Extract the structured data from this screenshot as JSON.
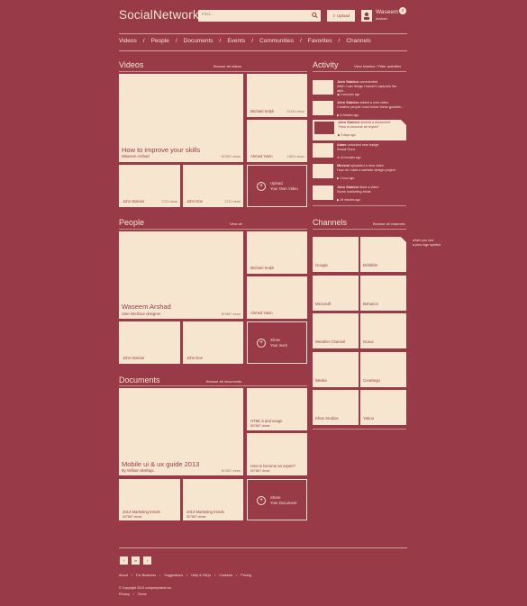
{
  "header": {
    "logo_a": "Social",
    "logo_b": "Network",
    "search_placeholder": "Find...",
    "upload_label": "Upload",
    "user_first": "Waseem",
    "user_last": "Arshad",
    "notif_count": "2"
  },
  "nav": [
    "Videos",
    "People",
    "Documents",
    "Events",
    "Communities",
    "Favorites",
    "Channels"
  ],
  "videos": {
    "title": "Videos",
    "link": "Browse all videos",
    "feature_title": "How to improve your skills",
    "feature_author": "Waseem Arshad",
    "feature_views": "507867 views",
    "s1_name": "Michael Kelph",
    "s1_views": "37434 views",
    "s2_name": "Ahmed Yasin",
    "s2_views": "13804 views",
    "s3_name": "John Stainior",
    "s3_views": "2723 views",
    "s4_name": "John Doe",
    "s4_views": "2723 views",
    "upload_l1": "Upload",
    "upload_l2": "Your Own Video"
  },
  "people": {
    "title": "People",
    "link": "View all",
    "feature_name": "Waseem Arshad",
    "feature_role": "User interface designer",
    "feature_views": "507867 views",
    "s1_name": "Michael Kelph",
    "s2_name": "Ahmed Yasin",
    "s3_name": "John Stainior",
    "s4_name": "John Doe",
    "show_l1": "Show",
    "show_l2": "Your work"
  },
  "documents": {
    "title": "Documents",
    "link": "Browse all documents",
    "feature_title": "Mobile ui & ux guide 2013",
    "feature_author": "By William Mathaja",
    "feature_views": "507867 views",
    "s1_title": "HTML 5 and usage",
    "s1_views": "507867 views",
    "s2_title": "How to become an expert?",
    "s2_views": "507867 views",
    "s3_title": "2013 Marketing trends",
    "s3_views": "507867 views",
    "s4_title": "2013 Marketing trends",
    "s4_views": "507867 views",
    "share_l1": "Share",
    "share_l2": "Your Document"
  },
  "activity": {
    "title": "Activity",
    "link": "View timeline / Filter activities",
    "items": [
      {
        "name": "John Stainior",
        "action": "commented",
        "text": "Wish I can things I haven't captures the abili...",
        "time": "2 seconds ago"
      },
      {
        "name": "John Stainior",
        "action": "added a new video",
        "text": "Creative people must follow these guidelin...",
        "time": "8 minutes ago"
      },
      {
        "name": "John Stainior",
        "action": "shared a document",
        "text": "\"How to become an expert\"",
        "time": "3 days ago"
      },
      {
        "name": "Adam",
        "action": "unlocked new badge",
        "text": "Social Guru",
        "time": "44 minutes ago"
      },
      {
        "name": "Micheal",
        "action": "uploaded a new video",
        "text": "How do i start a website design project",
        "time": "1 hour ago"
      },
      {
        "name": "John Stainior",
        "action": "liked a video",
        "text": "Some marketing tricks",
        "time": "19 minutes ago"
      }
    ]
  },
  "channels": {
    "title": "Channels",
    "link": "Browse all channels",
    "items": [
      "Google",
      "Dribbble",
      "Microsoft",
      "Behance",
      "Weather Channel",
      "Gurus",
      "iMedia",
      "Creattego",
      "Khan Studios",
      "Yahoo"
    ],
    "tip_l1": "when you see",
    "tip_l2": "a plus sign symbol"
  },
  "footer": {
    "social": [
      "t",
      "in",
      "f"
    ],
    "links": [
      "About",
      "For Business",
      "Suggestions",
      "Help & FAQs",
      "Contacts",
      "Pricing"
    ],
    "copyright": "© Copyright 2013 companyname inc.",
    "policy": [
      "Privacy",
      "Terms"
    ]
  },
  "colors": {
    "background": "#983a48",
    "tile": "#f6e6d0"
  }
}
